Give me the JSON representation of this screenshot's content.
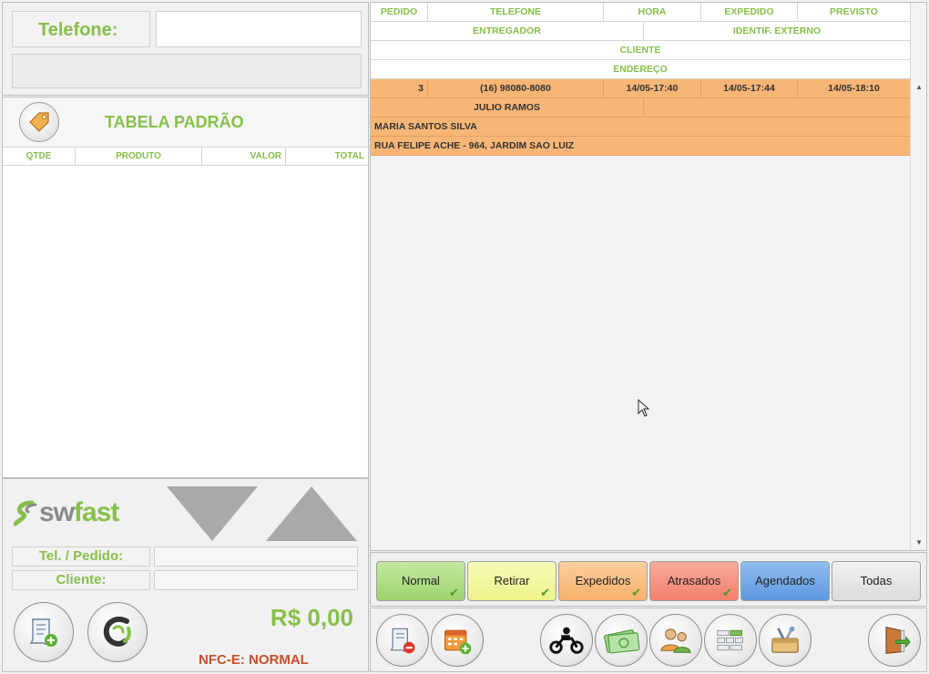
{
  "phone_lookup": {
    "label": "Telefone:",
    "value": ""
  },
  "price_table": {
    "title": "TABELA PADRÃO",
    "icon": "tag-icon"
  },
  "items_columns": [
    "QTDE",
    "PRODUTO",
    "VALOR",
    "TOTAL"
  ],
  "brand": {
    "sw": "sw",
    "fast": "fast"
  },
  "order_info": {
    "tel_label": "Tel. / Pedido:",
    "client_label": "Cliente:",
    "tel_value": "",
    "client_value": ""
  },
  "totals": {
    "total": "R$ 0,00",
    "nfce_status": "NFC-E: NORMAL"
  },
  "orders_grid": {
    "headers_row1": [
      "PEDIDO",
      "TELEFONE",
      "HORA",
      "EXPEDIDO",
      "PREVISTO"
    ],
    "headers_row2": [
      "ENTREGADOR",
      "IDENTIF. EXTERNO"
    ],
    "header_row3": "CLIENTE",
    "header_row4": "ENDEREÇO",
    "rows": [
      {
        "pedido": "3",
        "telefone": "(16) 98080-8080",
        "hora": "14/05-17:40",
        "expedido": "14/05-17:44",
        "previsto": "14/05-18:10",
        "entregador": "JULIO RAMOS",
        "identif_externo": "",
        "cliente": "MARIA SANTOS SILVA",
        "endereco": "RUA FELIPE ACHE - 964, JARDIM SAO LUIZ"
      }
    ]
  },
  "filters": [
    {
      "label": "Normal",
      "color": "#a8d878",
      "checked": true
    },
    {
      "label": "Retirar",
      "color": "#f0f590",
      "checked": true
    },
    {
      "label": "Expedidos",
      "color": "#f8b676",
      "checked": true
    },
    {
      "label": "Atrasados",
      "color": "#f68a78",
      "checked": true
    },
    {
      "label": "Agendados",
      "color": "#6fa3e6",
      "checked": false
    },
    {
      "label": "Todas",
      "color": "#e4e4e4",
      "checked": false
    }
  ],
  "colors": {
    "accent_green": "#86c04a",
    "nfce_orange": "#c8502a",
    "row_orange": "#f8b676"
  }
}
